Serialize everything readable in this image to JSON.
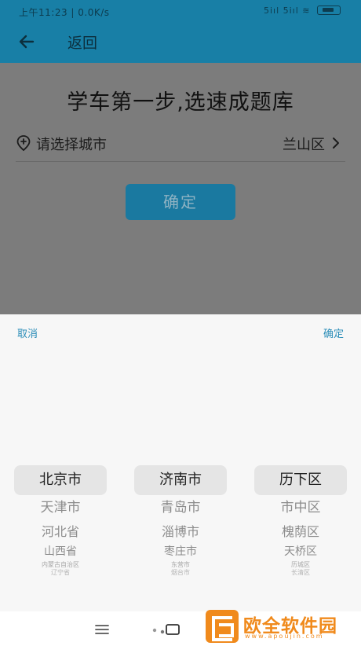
{
  "status_bar": {
    "time": "上午11:23 | 0.0K/s",
    "signal_label": "5iıl 5iıl ≋"
  },
  "header": {
    "back_label": "返回"
  },
  "main": {
    "heading": "学车第一步,选速成题库",
    "city_label": "请选择城市",
    "city_value": "兰山区",
    "confirm_label": "确定"
  },
  "picker": {
    "cancel_label": "取消",
    "ok_label": "确定",
    "provinces": [
      "北京市",
      "天津市",
      "河北省",
      "山西省",
      "内蒙古自治区",
      "辽宁省"
    ],
    "cities": [
      "济南市",
      "青岛市",
      "淄博市",
      "枣庄市",
      "东营市",
      "烟台市"
    ],
    "districts": [
      "历下区",
      "市中区",
      "槐荫区",
      "天桥区",
      "历城区",
      "长清区"
    ]
  },
  "watermark": {
    "text": "欧全软件园",
    "url": "www.apoujin.com"
  },
  "colors": {
    "primary": "#187fa6",
    "accent_text": "#2b8db8",
    "watermark": "#f08a1c"
  }
}
